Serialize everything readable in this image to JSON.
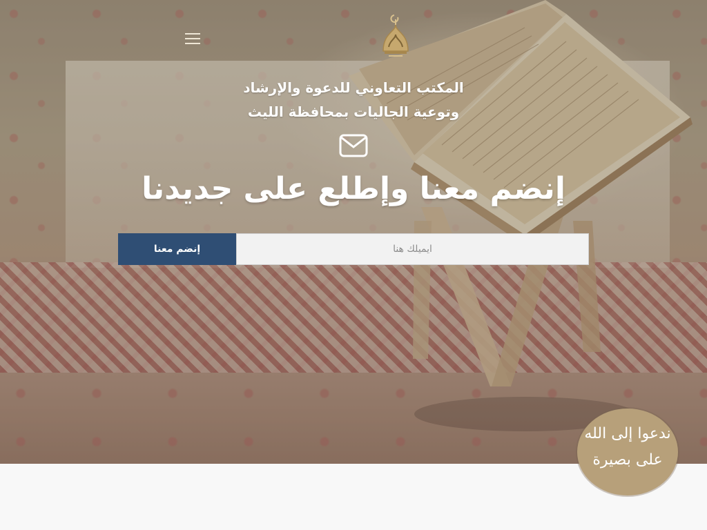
{
  "header": {
    "menu_icon": "hamburger-menu-icon",
    "logo_icon": "mosque-dome-logo-icon"
  },
  "hero": {
    "org_title_line1": "المكتب التعاوني للدعوة والإرشاد",
    "org_title_line2": "وتوعية الجاليات بمحافظة الليث",
    "mail_icon": "envelope-icon",
    "headline": "إنضم معنا وإطلع على جديدنا"
  },
  "subscribe": {
    "button_label": "إنضم معنا",
    "email_placeholder": "ايميلك هنا",
    "button_color": "#2f4e74"
  },
  "badge": {
    "line1": "ندعوا إلى الله",
    "line2": "على بصيرة",
    "color": "#b7a07a"
  }
}
